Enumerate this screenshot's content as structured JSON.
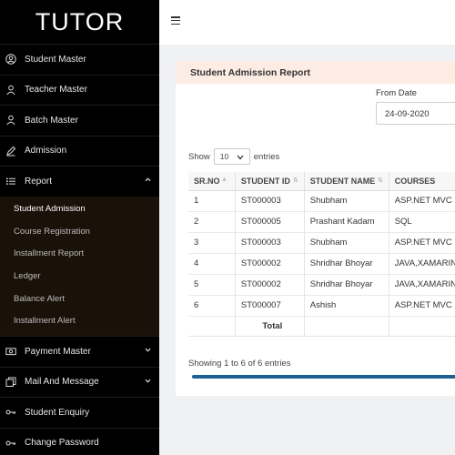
{
  "logo": "TUTOR",
  "sidebar": {
    "items": [
      {
        "label": "Student Master"
      },
      {
        "label": "Teacher Master"
      },
      {
        "label": "Batch Master"
      },
      {
        "label": "Admission"
      },
      {
        "label": "Report"
      }
    ],
    "report_sub": [
      {
        "label": "Student Admission"
      },
      {
        "label": "Course Registration"
      },
      {
        "label": "Installment Report"
      },
      {
        "label": "Ledger"
      },
      {
        "label": "Balance Alert"
      },
      {
        "label": "Installment Alert"
      }
    ],
    "bottom_items": [
      {
        "label": "Payment Master"
      },
      {
        "label": "Mail And Message"
      },
      {
        "label": "Student Enquiry"
      },
      {
        "label": "Change Password"
      }
    ]
  },
  "report": {
    "title": "Student Admission Report",
    "from_label": "From Date",
    "from_value": "24-09-2020",
    "show_label": "Show",
    "entries_value": "10",
    "entries_label": "entries",
    "columns": [
      "SR.NO",
      "STUDENT ID",
      "STUDENT NAME",
      "COURSES"
    ],
    "rows": [
      {
        "sr": "1",
        "id": "ST000003",
        "name": "Shubham",
        "course": "ASP.NET MVC"
      },
      {
        "sr": "2",
        "id": "ST000005",
        "name": "Prashant Kadam",
        "course": "SQL"
      },
      {
        "sr": "3",
        "id": "ST000003",
        "name": "Shubham",
        "course": "ASP.NET MVC"
      },
      {
        "sr": "4",
        "id": "ST000002",
        "name": "Shridhar Bhoyar",
        "course": "JAVA,XAMARIN"
      },
      {
        "sr": "5",
        "id": "ST000002",
        "name": "Shridhar Bhoyar",
        "course": "JAVA,XAMARIN"
      },
      {
        "sr": "6",
        "id": "ST000007",
        "name": "Ashish",
        "course": "ASP.NET MVC"
      }
    ],
    "total_label": "Total",
    "info": "Showing 1 to 6 of 6 entries"
  },
  "colors": {
    "sidebar_bg": "#000000",
    "header_bg": "#fdece3",
    "scroll_thumb": "#1f5f93"
  }
}
